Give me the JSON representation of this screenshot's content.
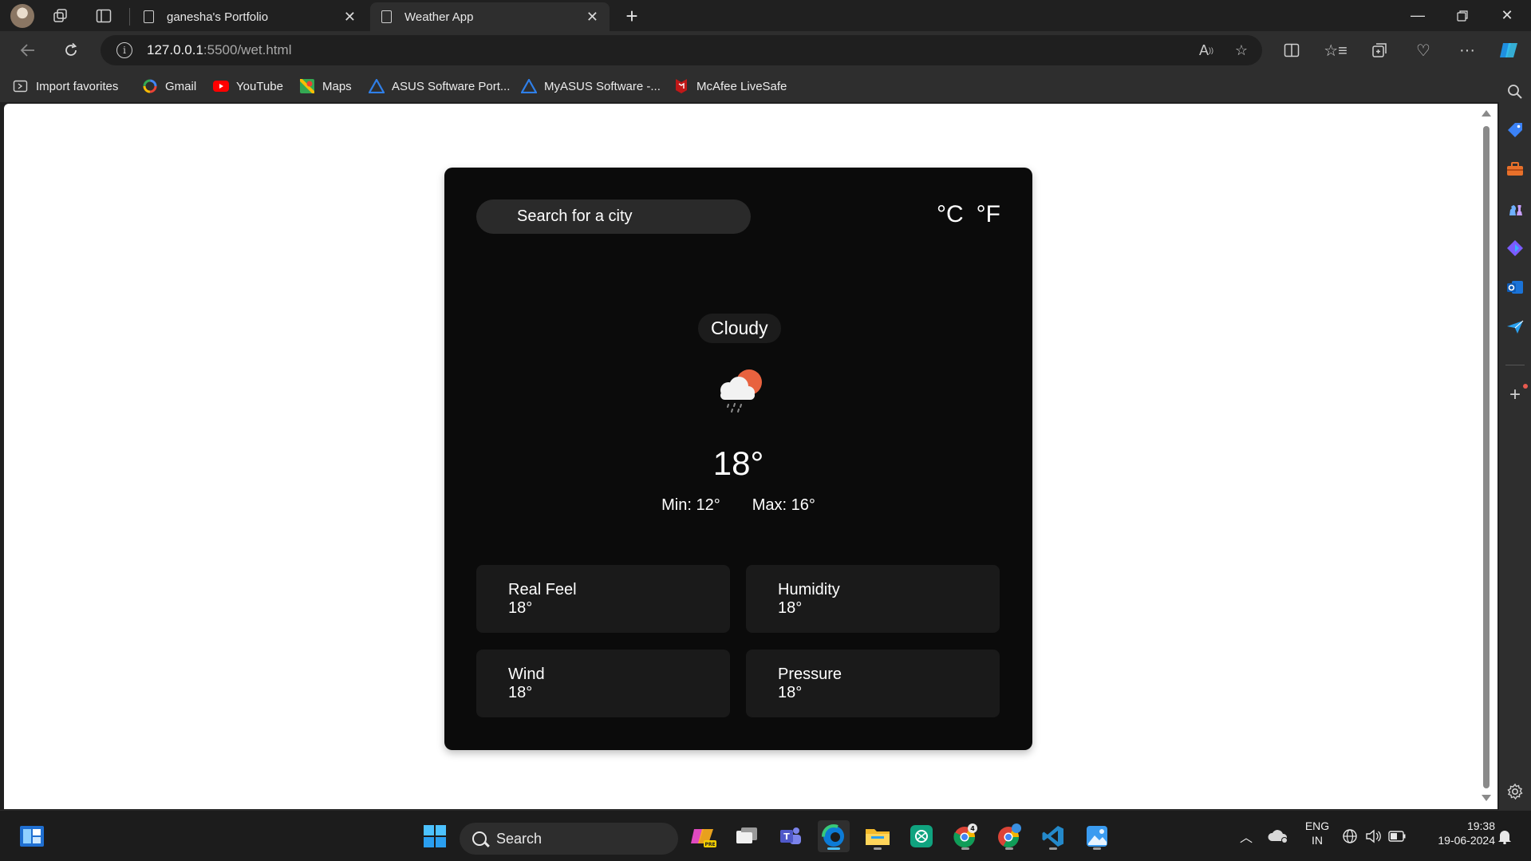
{
  "browser": {
    "tabs": [
      {
        "title": "ganesha's Portfolio",
        "active": false
      },
      {
        "title": "Weather App",
        "active": true
      }
    ],
    "address": {
      "host": "127.0.0.1",
      "path": ":5500/wet.html"
    },
    "favorites": [
      {
        "label": "Import favorites",
        "icon": "import-favorites-icon"
      },
      {
        "label": "Gmail",
        "icon": "google-icon"
      },
      {
        "label": "YouTube",
        "icon": "youtube-icon"
      },
      {
        "label": "Maps",
        "icon": "maps-icon"
      },
      {
        "label": "ASUS Software Port...",
        "icon": "asus-icon"
      },
      {
        "label": "MyASUS Software -...",
        "icon": "asus-icon"
      },
      {
        "label": "McAfee LiveSafe",
        "icon": "mcafee-icon"
      }
    ]
  },
  "weather": {
    "search_placeholder": "Search for a city",
    "unit_celsius": "°C",
    "unit_fahrenheit": "°F",
    "condition": "Cloudy",
    "temperature": "18°",
    "min": "Min: 12°",
    "max": "Max: 16°",
    "details": [
      {
        "label": "Real Feel",
        "value": "18°"
      },
      {
        "label": "Humidity",
        "value": "18°"
      },
      {
        "label": "Wind",
        "value": "18°"
      },
      {
        "label": "Pressure",
        "value": "18°"
      }
    ]
  },
  "taskbar": {
    "search_label": "Search",
    "language": "ENG",
    "region": "IN",
    "time": "19:38",
    "date": "19-06-2024",
    "chrome_badge": "4"
  },
  "colors": {
    "card_bg": "#0b0b0b",
    "detail_bg": "#1a1a1a",
    "sun": "#e8623f",
    "edge_accent": "#1f8fe0"
  }
}
